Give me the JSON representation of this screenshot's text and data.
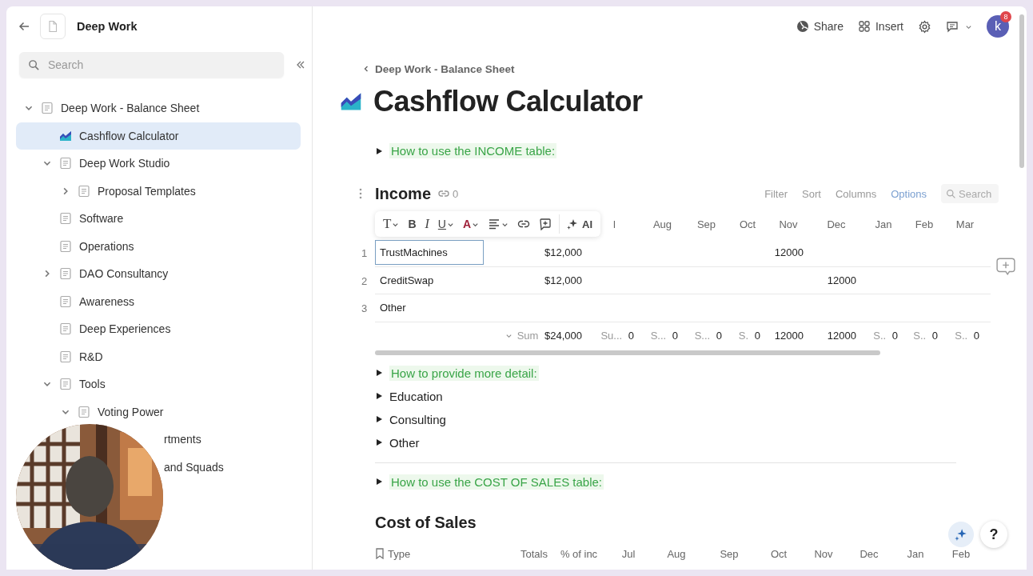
{
  "sidebar": {
    "title": "Deep Work",
    "search_placeholder": "Search",
    "tree": [
      {
        "label": "Deep Work - Balance Sheet",
        "kind": "page",
        "expanded": true,
        "selected": false,
        "children": [
          {
            "label": "Cashflow Calculator",
            "kind": "chart",
            "selected": true
          },
          {
            "label": "Deep Work Studio",
            "kind": "page",
            "expanded": true,
            "selected": false,
            "children": [
              {
                "label": "Proposal Templates",
                "kind": "page",
                "expanded": false,
                "selected": false
              }
            ]
          },
          {
            "label": "Software",
            "kind": "page",
            "selected": false
          },
          {
            "label": "Operations",
            "kind": "page",
            "selected": false
          },
          {
            "label": "DAO Consultancy",
            "kind": "page",
            "expanded": false,
            "selected": false
          },
          {
            "label": "Awareness",
            "kind": "page",
            "selected": false
          },
          {
            "label": "Deep Experiences",
            "kind": "page",
            "selected": false
          },
          {
            "label": "R&D",
            "kind": "page",
            "selected": false
          },
          {
            "label": "Tools",
            "kind": "page",
            "expanded": true,
            "selected": false,
            "children": [
              {
                "label": "Voting Power",
                "kind": "page",
                "expanded": true,
                "selected": false,
                "children": [
                  {
                    "label": "rtments",
                    "selected": false
                  },
                  {
                    "label": "and Squads",
                    "selected": false
                  }
                ]
              }
            ]
          }
        ]
      }
    ]
  },
  "topbar": {
    "share": "Share",
    "insert": "Insert",
    "avatar": "k",
    "badge": "8"
  },
  "breadcrumb": "Deep Work - Balance Sheet",
  "title": "Cashflow Calculator",
  "income_hint": {
    "label": "How to use the INCOME table:",
    "expanded": false
  },
  "income": {
    "title": "Income",
    "link_count": "0",
    "actions": [
      {
        "label": "Filter",
        "selected": false
      },
      {
        "label": "Sort",
        "selected": false
      },
      {
        "label": "Columns",
        "selected": false
      },
      {
        "label": "Options",
        "selected": true
      }
    ],
    "search_placeholder": "Search",
    "toolbar": [
      {
        "kind": "type",
        "label": "T",
        "caret": true
      },
      {
        "kind": "bold",
        "label": "B",
        "caret": false
      },
      {
        "kind": "italic",
        "label": "I",
        "caret": false
      },
      {
        "kind": "underline",
        "label": "U",
        "caret": true
      },
      {
        "kind": "color",
        "label": "A",
        "caret": true
      },
      {
        "kind": "align",
        "caret": true
      },
      {
        "kind": "link",
        "caret": false
      },
      {
        "kind": "comment",
        "caret": false
      },
      {
        "kind": "ai",
        "label": "AI",
        "caret": false
      }
    ],
    "header": [
      "l",
      "Aug",
      "Sep",
      "Oct",
      "Nov",
      "Dec",
      "Jan",
      "Feb",
      "Mar"
    ],
    "rows": [
      {
        "number": "1",
        "selected": true,
        "cells": [
          "TrustMachines",
          "$12,000",
          null,
          null,
          null,
          null,
          "12000",
          null,
          null,
          null,
          null
        ]
      },
      {
        "number": "2",
        "selected": false,
        "cells": [
          "CreditSwap",
          "$12,000",
          null,
          null,
          null,
          null,
          null,
          "12000",
          null,
          null,
          null
        ]
      },
      {
        "number": "3",
        "selected": false,
        "cells": [
          "Other",
          null,
          null,
          null,
          null,
          null,
          null,
          null,
          null,
          null,
          null
        ]
      }
    ],
    "summary": [
      {
        "label": "Sum",
        "value": "$24,000"
      },
      {
        "label": "Su...",
        "value": "0"
      },
      {
        "label": "S...",
        "value": "0"
      },
      {
        "label": "S...",
        "value": "0"
      },
      {
        "label": "S.",
        "value": "0"
      },
      {
        "value": "12000"
      },
      {
        "value": "12000"
      },
      {
        "label": "S..",
        "value": "0"
      },
      {
        "label": "S..",
        "value": "0"
      },
      {
        "label": "S..",
        "value": "0"
      }
    ]
  },
  "toggles": [
    {
      "label": "How to provide more detail:",
      "kind": "hint",
      "expanded": false
    },
    {
      "label": "Education",
      "kind": "plain",
      "expanded": false
    },
    {
      "label": "Consulting",
      "kind": "plain",
      "expanded": false
    },
    {
      "label": "Other",
      "kind": "plain",
      "expanded": false
    }
  ],
  "cost_hint": {
    "label": "How to use the COST OF SALES table:",
    "expanded": false
  },
  "cost_of_sales": {
    "title": "Cost of Sales",
    "columns": [
      "Type",
      "Totals",
      "% of inc",
      "Jul",
      "Aug",
      "Sep",
      "Oct",
      "Nov",
      "Dec",
      "Jan",
      "Feb"
    ]
  },
  "help_button": "?"
}
